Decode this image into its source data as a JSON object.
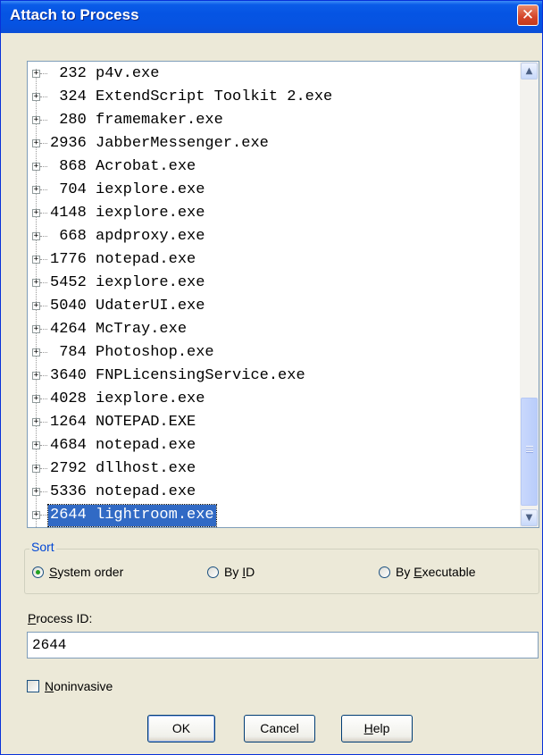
{
  "window": {
    "title": "Attach to Process",
    "close_glyph": "✕"
  },
  "processes": [
    {
      "pid": " 232",
      "name": "p4v.exe"
    },
    {
      "pid": " 324",
      "name": "ExtendScript Toolkit 2.exe"
    },
    {
      "pid": " 280",
      "name": "framemaker.exe"
    },
    {
      "pid": "2936",
      "name": "JabberMessenger.exe"
    },
    {
      "pid": " 868",
      "name": "Acrobat.exe"
    },
    {
      "pid": " 704",
      "name": "iexplore.exe"
    },
    {
      "pid": "4148",
      "name": "iexplore.exe"
    },
    {
      "pid": " 668",
      "name": "apdproxy.exe"
    },
    {
      "pid": "1776",
      "name": "notepad.exe"
    },
    {
      "pid": "5452",
      "name": "iexplore.exe"
    },
    {
      "pid": "5040",
      "name": "UdaterUI.exe"
    },
    {
      "pid": "4264",
      "name": "McTray.exe"
    },
    {
      "pid": " 784",
      "name": "Photoshop.exe"
    },
    {
      "pid": "3640",
      "name": "FNPLicensingService.exe"
    },
    {
      "pid": "4028",
      "name": "iexplore.exe"
    },
    {
      "pid": "1264",
      "name": "NOTEPAD.EXE"
    },
    {
      "pid": "4684",
      "name": "notepad.exe"
    },
    {
      "pid": "2792",
      "name": "dllhost.exe"
    },
    {
      "pid": "5336",
      "name": "notepad.exe"
    },
    {
      "pid": "2644",
      "name": "lightroom.exe",
      "selected": true
    }
  ],
  "sort": {
    "label": "Sort",
    "options": [
      {
        "mnemonic": "S",
        "rest": "ystem order",
        "prefix": "",
        "selected": true
      },
      {
        "prefix": "By ",
        "mnemonic": "I",
        "rest": "D",
        "selected": false
      },
      {
        "prefix": "By ",
        "mnemonic": "E",
        "rest": "xecutable",
        "selected": false
      }
    ]
  },
  "process_id": {
    "label_mnemonic": "P",
    "label_rest": "rocess ID:",
    "value": "2644"
  },
  "noninvasive": {
    "mnemonic": "N",
    "rest": "oninvasive",
    "checked": false
  },
  "buttons": {
    "ok": "OK",
    "cancel": "Cancel",
    "help_mnemonic": "H",
    "help_rest": "elp"
  },
  "colors": {
    "selection": "#316ac5",
    "title_bar": "#0554e3",
    "group_label": "#0046d5"
  }
}
